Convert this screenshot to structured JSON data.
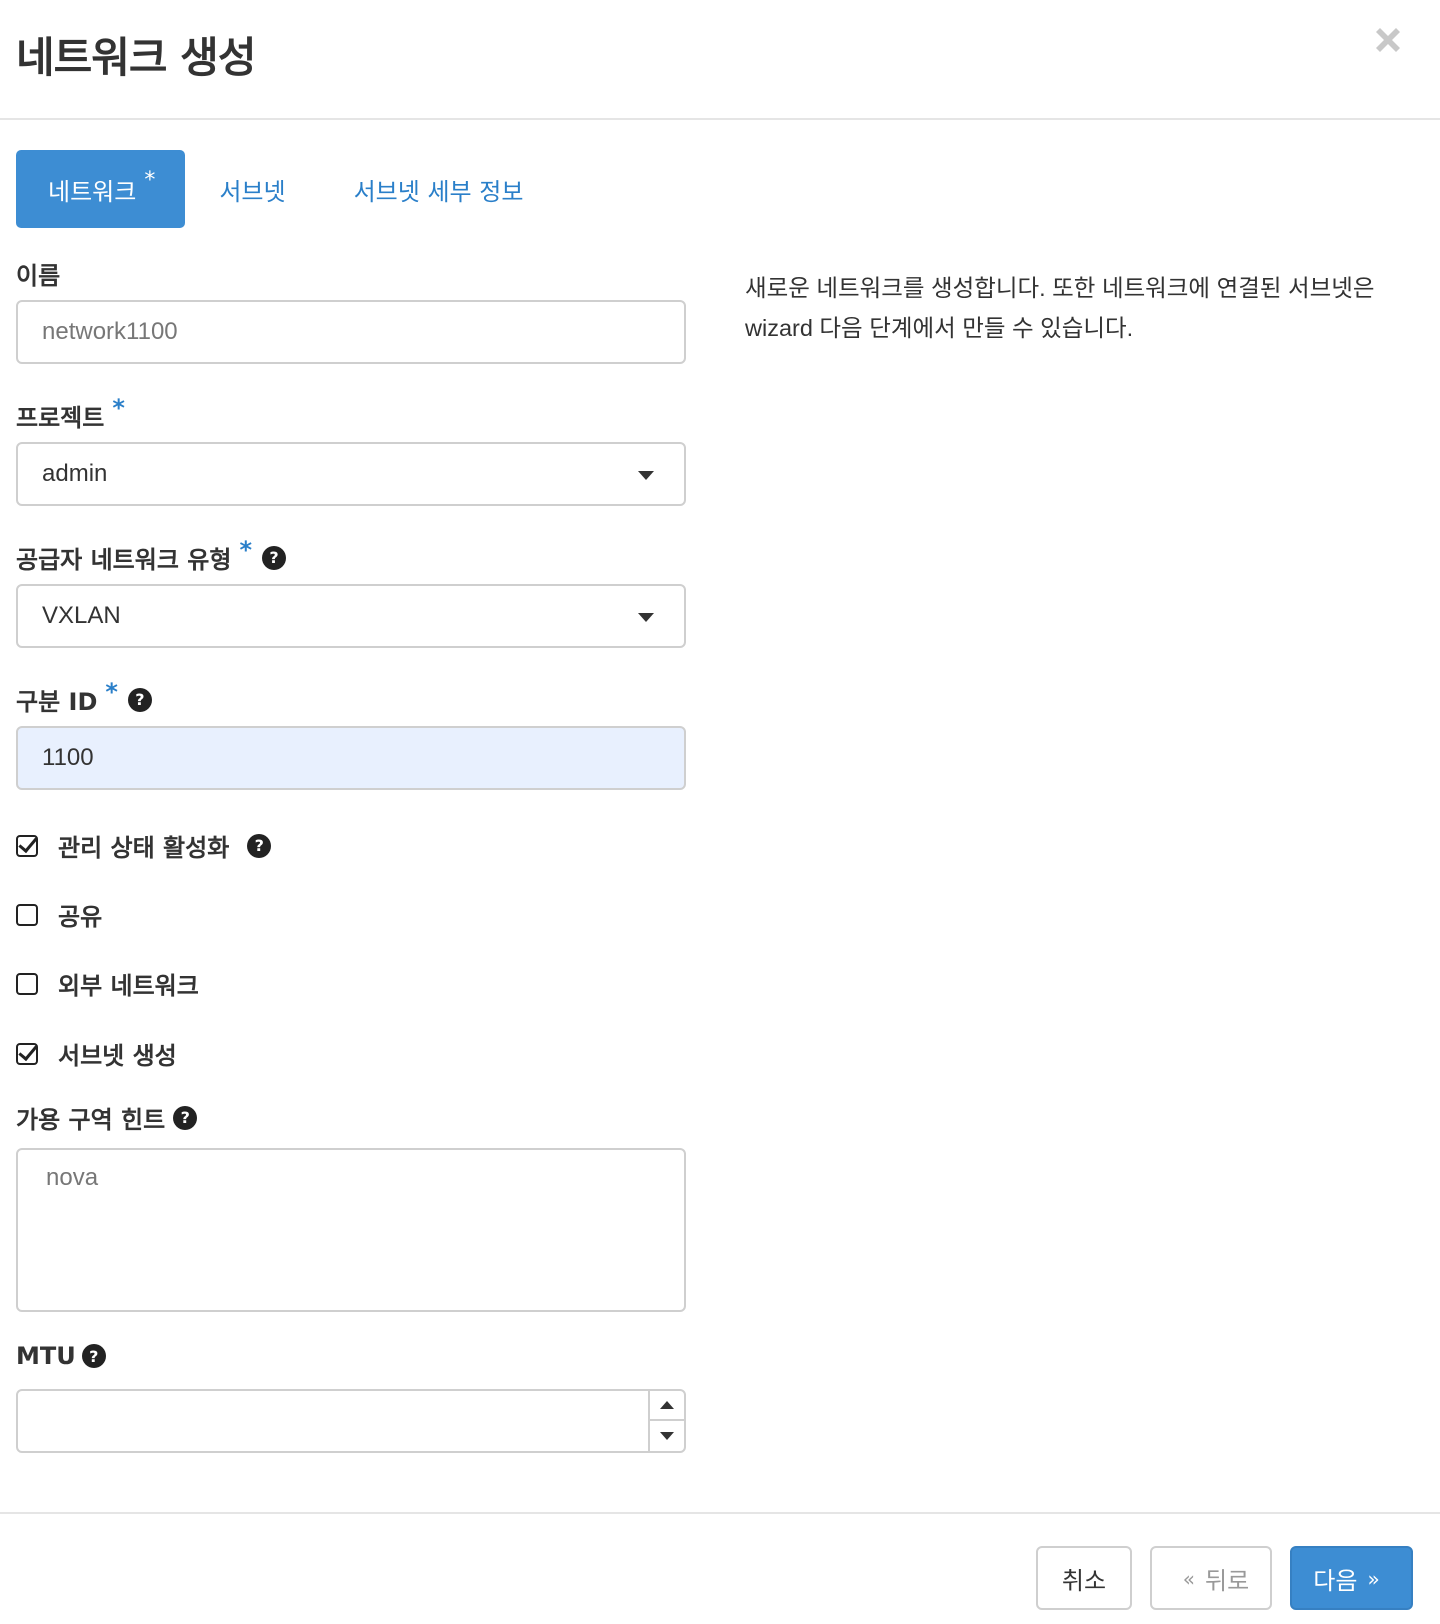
{
  "dialog": {
    "title": "네트워크 생성",
    "close_icon": "close-icon"
  },
  "tabs": [
    {
      "label": "네트워크",
      "required_mark": "*",
      "active": true
    },
    {
      "label": "서브넷",
      "active": false
    },
    {
      "label": "서브넷 세부 정보",
      "active": false
    }
  ],
  "form": {
    "name": {
      "label": "이름",
      "placeholder": "network1100",
      "value": ""
    },
    "project": {
      "label": "프로젝트",
      "required_mark": "*",
      "value": "admin"
    },
    "provider_network_type": {
      "label": "공급자 네트워크 유형",
      "required_mark": "*",
      "help_icon": "?",
      "value": "VXLAN"
    },
    "segmentation_id": {
      "label": "구분 ID",
      "required_mark": "*",
      "help_icon": "?",
      "value": "1100"
    },
    "admin_state": {
      "label": "관리 상태 활성화",
      "help_icon": "?",
      "checked": true
    },
    "shared": {
      "label": "공유",
      "checked": false
    },
    "external_network": {
      "label": "외부 네트워크",
      "checked": false
    },
    "create_subnet": {
      "label": "서브넷 생성",
      "checked": true
    },
    "az_hints": {
      "label": "가용 구역 힌트",
      "help_icon": "?",
      "placeholder": "nova"
    },
    "mtu": {
      "label": "MTU",
      "help_icon": "?",
      "value": ""
    }
  },
  "description": "새로운 네트워크를 생성합니다. 또한 네트워크에 연결된 서브넷은 wizard 다음 단계에서 만들 수 있습니다.",
  "footer": {
    "cancel_label": "취소",
    "back_label": "뒤로",
    "back_chevron": "«",
    "next_label": "다음",
    "next_chevron": "»"
  },
  "colors": {
    "primary": "#3d8dd3",
    "link": "#2a7fc9",
    "autofill_bg": "#e8f0fe",
    "border": "#cfcfcf"
  }
}
